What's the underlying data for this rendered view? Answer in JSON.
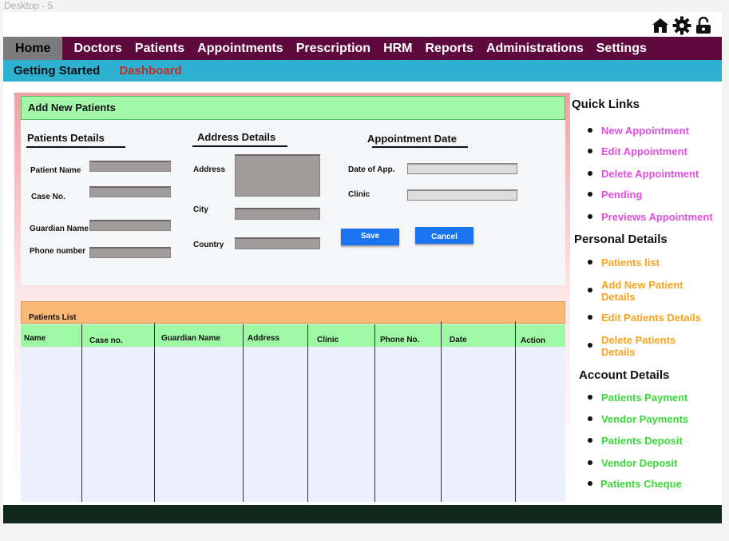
{
  "frame_label": "Desktop - 5",
  "header_icons": [
    "home-icon",
    "gear-icon",
    "unlock-icon"
  ],
  "nav": {
    "items": [
      "Home",
      "Doctors",
      "Patients",
      "Appointments",
      "Prescription",
      "HRM",
      "Reports",
      "Administrations",
      "Settings"
    ],
    "active": "Home"
  },
  "subnav": {
    "getting_started": "Getting Started",
    "dashboard": "Dashboard"
  },
  "form": {
    "title": "Add New Patients",
    "patients_details": {
      "title": "Patients Details",
      "patient_name": "Patient Name",
      "case_no": "Case No.",
      "guardian_name": "Guardian Name",
      "phone_number": "Phone number"
    },
    "address_details": {
      "title": "Address Details",
      "address": "Address",
      "city": "City",
      "country": "Country"
    },
    "appointment": {
      "title": "Appointment  Date",
      "date_of_app": "Date of App.",
      "clinic": "Clinic"
    },
    "save_label": "Save",
    "cancel_label": "Cancel"
  },
  "patients_list": {
    "title": "Patients List",
    "columns": [
      "Name",
      "Case no.",
      "Guardian Name",
      "Address",
      "Clinic",
      "Phone No.",
      "Date",
      "Action"
    ]
  },
  "sidebar": {
    "quick_links": {
      "title": "Quick Links",
      "items": [
        "New Appointment",
        "Edit Appointment",
        "Delete Appointment",
        "Pending",
        "Previews Appointment"
      ]
    },
    "personal_details": {
      "title": "Personal Details",
      "items": [
        "Patients list",
        "Add New Patient Details",
        "Edit Patients Details",
        "Delete Patients Details"
      ]
    },
    "account_details": {
      "title": "Account Details",
      "items": [
        "Patients Payment",
        "Vendor Payments",
        "Patients Deposit",
        "Vendor Deposit",
        "Patients Cheque"
      ]
    }
  },
  "colors": {
    "nav_bg": "#5e0a3f",
    "subnav_bg": "#2eb1d0",
    "form_header_bg": "#a3f7aa",
    "list_header_bg": "#fbb978",
    "button_blue": "#1a74f0",
    "quick_link_color": "#e04ee0",
    "personal_link_color": "#f7a31e",
    "account_link_color": "#3ad93a",
    "footer_bg": "#10281c"
  }
}
